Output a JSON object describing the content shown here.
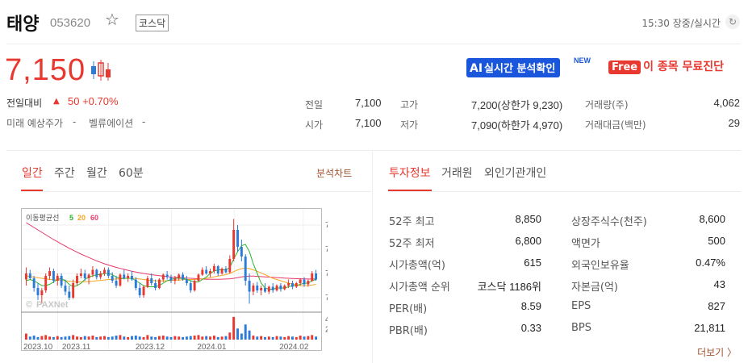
{
  "header": {
    "name": "태양",
    "code": "053620",
    "market": "코스닥",
    "timestamp": "15:30 장중/실시간"
  },
  "price": {
    "current": "7,150",
    "change_label": "전일대비",
    "change_value": "50 +0.70%",
    "expected_label": "미래 예상주가",
    "expected_value": "-",
    "valuation_label": "벨류에이션",
    "valuation_value": "-"
  },
  "promo": {
    "ai_tag": "AI",
    "ai_label": "실시간 분석확인",
    "new": "NEW",
    "free_tag": "Free",
    "free_label": "이 종목 무료진단"
  },
  "quote": {
    "prev_label": "전일",
    "prev": "7,100",
    "open_label": "시가",
    "open": "7,100",
    "high_label": "고가",
    "high": "7,200(상한가 9,230)",
    "low_label": "저가",
    "low": "7,090(하한가 4,970)",
    "volume_label": "거래량(주)",
    "volume": "4,062",
    "amount_label": "거래대금(백만)",
    "amount": "29"
  },
  "chart_tabs": [
    "일간",
    "주간",
    "월간",
    "60분"
  ],
  "analysis_chart": "분석차트",
  "info_tabs": [
    "투자정보",
    "거래원",
    "외인기관개인"
  ],
  "chart": {
    "ma_label": "이동평균선",
    "ma5": "5",
    "ma20": "20",
    "ma60": "60",
    "watermark": "PAXNet",
    "price_ticks": [
      "7,600",
      "7,400",
      "7,200",
      "7,000"
    ],
    "volume_ticks": [
      "40K",
      "20K"
    ],
    "x_ticks": [
      "2023.10",
      "2023.11",
      "2023.12",
      "2024.01",
      "2024.02"
    ],
    "colors": {
      "ma5": "#2ab52a",
      "ma20": "#f5a623",
      "ma60": "#e63a6a",
      "up": "#e8382f",
      "down": "#2c7bd9"
    }
  },
  "chart_data": {
    "type": "bar",
    "title": "",
    "price_axis_range": [
      6900,
      7700
    ],
    "volume_axis_range": [
      0,
      48000
    ],
    "candles": [
      [
        7150,
        7250,
        7100,
        7200
      ],
      [
        7200,
        7230,
        7150,
        7160
      ],
      [
        7160,
        7180,
        7050,
        7080
      ],
      [
        7080,
        7120,
        6980,
        7020
      ],
      [
        7020,
        7080,
        6950,
        7060
      ],
      [
        7060,
        7200,
        7040,
        7180
      ],
      [
        7180,
        7250,
        7150,
        7220
      ],
      [
        7220,
        7240,
        7120,
        7140
      ],
      [
        7140,
        7200,
        7100,
        7180
      ],
      [
        7180,
        7200,
        7080,
        7100
      ],
      [
        7100,
        7150,
        7020,
        7050
      ],
      [
        7050,
        7100,
        6980,
        7000
      ],
      [
        7000,
        7150,
        6990,
        7120
      ],
      [
        7120,
        7200,
        7100,
        7180
      ],
      [
        7180,
        7240,
        7160,
        7200
      ],
      [
        7200,
        7230,
        7140,
        7160
      ],
      [
        7160,
        7200,
        7110,
        7190
      ],
      [
        7190,
        7260,
        7170,
        7230
      ],
      [
        7230,
        7240,
        7150,
        7170
      ],
      [
        7170,
        7220,
        7150,
        7200
      ],
      [
        7200,
        7250,
        7180,
        7230
      ],
      [
        7230,
        7250,
        7160,
        7180
      ],
      [
        7180,
        7210,
        7120,
        7140
      ],
      [
        7140,
        7180,
        7080,
        7100
      ],
      [
        7100,
        7200,
        7090,
        7190
      ],
      [
        7190,
        7230,
        7150,
        7160
      ],
      [
        7160,
        7200,
        7130,
        7180
      ],
      [
        7180,
        7220,
        7140,
        7150
      ],
      [
        7150,
        7170,
        7060,
        7080
      ],
      [
        7080,
        7120,
        7000,
        7020
      ],
      [
        7020,
        7100,
        7000,
        7090
      ],
      [
        7090,
        7180,
        7080,
        7160
      ],
      [
        7160,
        7200,
        7100,
        7120
      ],
      [
        7120,
        7150,
        7060,
        7080
      ],
      [
        7080,
        7160,
        7070,
        7150
      ],
      [
        7150,
        7200,
        7130,
        7190
      ],
      [
        7190,
        7220,
        7150,
        7170
      ],
      [
        7170,
        7190,
        7120,
        7140
      ],
      [
        7140,
        7180,
        7110,
        7160
      ],
      [
        7160,
        7200,
        7140,
        7190
      ],
      [
        7190,
        7210,
        7140,
        7150
      ],
      [
        7150,
        7180,
        7100,
        7120
      ],
      [
        7120,
        7140,
        7040,
        7060
      ],
      [
        7060,
        7150,
        7050,
        7140
      ],
      [
        7140,
        7200,
        7130,
        7190
      ],
      [
        7190,
        7250,
        7180,
        7230
      ],
      [
        7230,
        7260,
        7190,
        7200
      ],
      [
        7200,
        7240,
        7170,
        7220
      ],
      [
        7220,
        7280,
        7200,
        7260
      ],
      [
        7260,
        7270,
        7180,
        7200
      ],
      [
        7200,
        7250,
        7190,
        7240
      ],
      [
        7240,
        7260,
        7200,
        7210
      ],
      [
        7210,
        7350,
        7200,
        7320
      ],
      [
        7320,
        7650,
        7300,
        7560
      ],
      [
        7560,
        7600,
        7380,
        7420
      ],
      [
        7420,
        7480,
        7300,
        7340
      ],
      [
        7340,
        7360,
        7100,
        7140
      ],
      [
        7140,
        7200,
        6950,
        7050
      ],
      [
        7050,
        7120,
        7020,
        7100
      ],
      [
        7100,
        7130,
        7040,
        7060
      ],
      [
        7060,
        7100,
        7020,
        7080
      ],
      [
        7080,
        7120,
        7040,
        7050
      ],
      [
        7050,
        7100,
        7030,
        7090
      ],
      [
        7090,
        7120,
        7040,
        7060
      ],
      [
        7060,
        7110,
        7050,
        7100
      ],
      [
        7100,
        7120,
        7050,
        7070
      ],
      [
        7070,
        7110,
        7060,
        7100
      ],
      [
        7100,
        7150,
        7080,
        7120
      ],
      [
        7120,
        7140,
        7070,
        7090
      ],
      [
        7090,
        7130,
        7080,
        7120
      ],
      [
        7120,
        7160,
        7100,
        7150
      ],
      [
        7150,
        7170,
        7090,
        7110
      ],
      [
        7110,
        7150,
        7090,
        7140
      ],
      [
        7140,
        7220,
        7130,
        7200
      ],
      [
        7200,
        7230,
        7140,
        7150
      ]
    ],
    "volumes": [
      12,
      6,
      8,
      5,
      7,
      9,
      6,
      5,
      7,
      5,
      6,
      7,
      9,
      6,
      5,
      7,
      6,
      8,
      5,
      6,
      7,
      5,
      6,
      8,
      9,
      6,
      5,
      7,
      8,
      6,
      5,
      9,
      6,
      5,
      7,
      8,
      6,
      5,
      7,
      6,
      5,
      6,
      7,
      8,
      9,
      6,
      7,
      6,
      8,
      5,
      6,
      7,
      14,
      45,
      22,
      12,
      30,
      18,
      8,
      6,
      7,
      5,
      6,
      5,
      7,
      6,
      5,
      7,
      6,
      5,
      8,
      6,
      7,
      9,
      6
    ],
    "ma5": [
      7140,
      7150,
      7140,
      7120,
      7100,
      7100,
      7110,
      7130,
      7150,
      7160,
      7140,
      7110,
      7090,
      7100,
      7120,
      7150,
      7170,
      7180,
      7190,
      7190,
      7200,
      7200,
      7190,
      7170,
      7160,
      7160,
      7160,
      7160,
      7140,
      7120,
      7100,
      7090,
      7090,
      7090,
      7100,
      7120,
      7140,
      7150,
      7160,
      7160,
      7160,
      7150,
      7140,
      7130,
      7130,
      7150,
      7170,
      7200,
      7220,
      7230,
      7230,
      7230,
      7250,
      7320,
      7380,
      7430,
      7440,
      7380,
      7280,
      7200,
      7120,
      7080,
      7070,
      7070,
      7080,
      7080,
      7080,
      7090,
      7100,
      7100,
      7110,
      7120,
      7120,
      7140,
      7150
    ],
    "ma20": [
      7180,
      7175,
      7170,
      7165,
      7160,
      7155,
      7150,
      7148,
      7146,
      7144,
      7140,
      7136,
      7132,
      7130,
      7130,
      7132,
      7134,
      7136,
      7140,
      7142,
      7146,
      7150,
      7152,
      7154,
      7156,
      7158,
      7160,
      7160,
      7158,
      7154,
      7150,
      7146,
      7142,
      7140,
      7138,
      7138,
      7140,
      7142,
      7144,
      7146,
      7148,
      7150,
      7150,
      7150,
      7152,
      7156,
      7160,
      7166,
      7172,
      7178,
      7184,
      7190,
      7200,
      7215,
      7230,
      7240,
      7245,
      7240,
      7230,
      7218,
      7205,
      7190,
      7175,
      7160,
      7150,
      7140,
      7130,
      7120,
      7112,
      7106,
      7100,
      7098,
      7100,
      7104,
      7110
    ],
    "ma60": [
      7620,
      7600,
      7580,
      7560,
      7540,
      7520,
      7500,
      7480,
      7462,
      7444,
      7426,
      7408,
      7392,
      7376,
      7360,
      7346,
      7332,
      7318,
      7304,
      7292,
      7280,
      7270,
      7260,
      7250,
      7242,
      7234,
      7226,
      7218,
      7212,
      7206,
      7200,
      7195,
      7190,
      7186,
      7182,
      7178,
      7174,
      7170,
      7168,
      7166,
      7164,
      7162,
      7160,
      7158,
      7156,
      7154,
      7152,
      7152,
      7152,
      7152,
      7153,
      7154,
      7156,
      7160,
      7166,
      7172,
      7176,
      7178,
      7178,
      7176,
      7174,
      7172,
      7170,
      7168,
      7166,
      7164,
      7162,
      7160,
      7158,
      7157,
      7156,
      7155,
      7154,
      7154,
      7154
    ]
  },
  "info": {
    "left": [
      {
        "label": "52주 최고",
        "value": "8,850"
      },
      {
        "label": "52주 최저",
        "value": "6,800"
      },
      {
        "label": "시가총액(억)",
        "value": "615"
      },
      {
        "label": "시가총액 순위",
        "value": "코스닥 1186위"
      },
      {
        "label": "PER(배)",
        "value": "8.59"
      },
      {
        "label": "PBR(배)",
        "value": "0.33"
      }
    ],
    "right": [
      {
        "label": "상장주식수(천주)",
        "value": "8,600"
      },
      {
        "label": "액면가",
        "value": "500"
      },
      {
        "label": "외국인보유율",
        "value": "0.47%"
      },
      {
        "label": "자본금(억)",
        "value": "43"
      },
      {
        "label": "EPS",
        "value": "827"
      },
      {
        "label": "BPS",
        "value": "21,811"
      }
    ],
    "more": "더보기 〉"
  }
}
